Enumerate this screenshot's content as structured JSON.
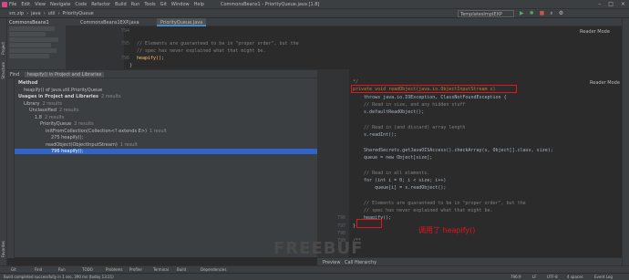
{
  "titlebar": {
    "menu": [
      "File",
      "Edit",
      "View",
      "Navigate",
      "Code",
      "Refactor",
      "Build",
      "Run",
      "Tools",
      "Git",
      "Window",
      "Help"
    ],
    "window_title": "CommonsBeans1 - PriorityQueue.java [1.8]"
  },
  "navbar": {
    "crumbs": [
      "src.zip",
      "java",
      "util",
      "PriorityQueue"
    ],
    "run_config": "TemplatesImplEXP"
  },
  "project": {
    "title": "CommonsBeans1"
  },
  "editor_tabs": [
    "CommonsBeans1EXP.java",
    "PriorityQueue.java"
  ],
  "top_editor": {
    "reader_mode": "Reader Mode",
    "lines": [
      {
        "num": "794",
        "text": ""
      },
      {
        "num": "795",
        "text": "// Elements are guaranteed to be in \"proper order\", but the"
      },
      {
        "num": "",
        "text": "// spec has never explained what that might be."
      },
      {
        "num": "796",
        "text": "heapify();"
      },
      {
        "num": "",
        "text": "}"
      }
    ]
  },
  "find": {
    "label": "Find",
    "tab": "heapify() in Project and Libraries",
    "tree": [
      {
        "indent": 0,
        "text": "Method",
        "bold": true
      },
      {
        "indent": 1,
        "text": "heapify() of java.util.PriorityQueue"
      },
      {
        "indent": 0,
        "text": "Usages in Project and Libraries",
        "extra": "2 results",
        "bold": true
      },
      {
        "indent": 1,
        "text": "Library",
        "extra": "2 results"
      },
      {
        "indent": 2,
        "text": "Unclassified",
        "extra": "2 results"
      },
      {
        "indent": 3,
        "text": "1.8",
        "extra": "2 results"
      },
      {
        "indent": 4,
        "text": "PriorityQueue",
        "extra": "2 results"
      },
      {
        "indent": 5,
        "text": "initFromCollection(Collection<? extends E>)",
        "extra": "1 result"
      },
      {
        "indent": 6,
        "text": "275 heapify();"
      },
      {
        "indent": 5,
        "text": "readObject(ObjectInputStream)",
        "extra": "1 result"
      },
      {
        "indent": 6,
        "text": "796 heapify();",
        "selected": true
      }
    ]
  },
  "bottom_editor": {
    "reader_mode": "Reader Mode",
    "lines": [
      {
        "num": "",
        "text": "*/",
        "cls": "cm"
      },
      {
        "num": "",
        "text": "private void readObject(java.io.ObjectInputStream s)",
        "cls": "sig"
      },
      {
        "num": "",
        "text": "    throws java.io.IOException, ClassNotFoundException {",
        "cls": "pl"
      },
      {
        "num": "",
        "text": "    // Read in size, and any hidden stuff",
        "cls": "cm"
      },
      {
        "num": "",
        "text": "    s.defaultReadObject();",
        "cls": "pl"
      },
      {
        "num": "",
        "text": "",
        "cls": "pl"
      },
      {
        "num": "",
        "text": "    // Read in (and discard) array length",
        "cls": "cm"
      },
      {
        "num": "",
        "text": "    s.readInt();",
        "cls": "pl"
      },
      {
        "num": "",
        "text": "",
        "cls": "pl"
      },
      {
        "num": "",
        "text": "    SharedSecrets.getJavaOISAccess().checkArray(s, Object[].class, size);",
        "cls": "pl"
      },
      {
        "num": "",
        "text": "    queue = new Object[size];",
        "cls": "pl"
      },
      {
        "num": "",
        "text": "",
        "cls": "pl"
      },
      {
        "num": "",
        "text": "    // Read in all elements.",
        "cls": "cm"
      },
      {
        "num": "",
        "text": "    for (int i = 0; i < size; i++)",
        "cls": "pl"
      },
      {
        "num": "",
        "text": "        queue[i] = s.readObject();",
        "cls": "pl"
      },
      {
        "num": "",
        "text": "",
        "cls": "pl"
      },
      {
        "num": "",
        "text": "    // Elements are guaranteed to be in \"proper order\", but the",
        "cls": "cm"
      },
      {
        "num": "",
        "text": "    // spec has never explained what that might be.",
        "cls": "cm"
      },
      {
        "num": "796",
        "text": "    heapify();",
        "cls": "pl"
      },
      {
        "num": "797",
        "text": "}",
        "cls": "pl"
      },
      {
        "num": "798",
        "text": "",
        "cls": "pl"
      },
      {
        "num": "799",
        "text": "/**",
        "cls": "cm"
      }
    ],
    "annotation": "调用了 heapify()"
  },
  "bottom_tabs": [
    "Preview",
    "Call Hierarchy"
  ],
  "tool_windows": [
    "Git",
    "Find",
    "Run",
    "TODO",
    "Problems",
    "Profiler",
    "Terminal",
    "Build",
    "Dependencies"
  ],
  "status": {
    "message": "Build completed successfully in 1 sec, 390 ms (today 13:21)",
    "position": "796:9",
    "line_sep": "LF",
    "encoding": "UTF-8",
    "indent": "4 spaces",
    "event_log": "Event Log"
  },
  "side_tabs": {
    "project": "Project",
    "structure": "Structure",
    "favorites": "Favorites"
  },
  "watermark": "FREEBUF"
}
